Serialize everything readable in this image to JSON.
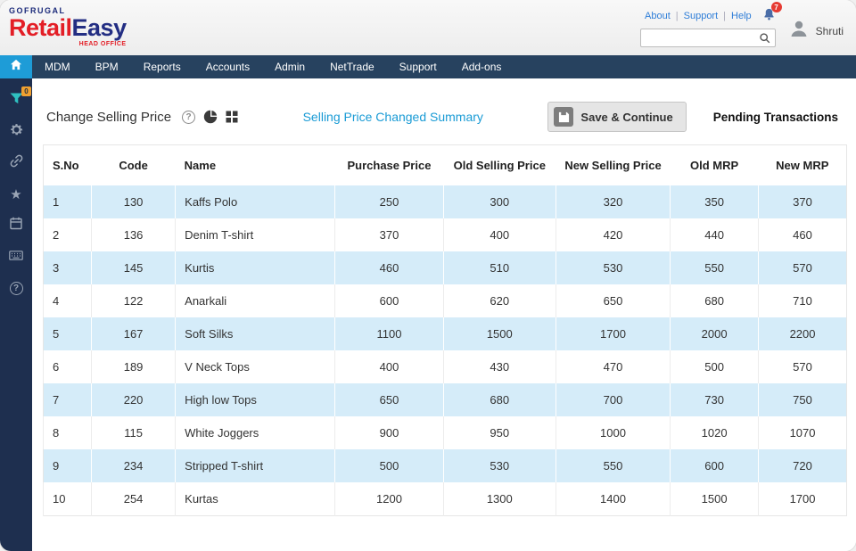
{
  "colors": {
    "navbar": "#27425f",
    "sidebar": "#1e2f4f",
    "accent_blue": "#1e9cd7",
    "link_blue": "#2f7ed8",
    "summary_link": "#1a9bd5",
    "row_alt": "#d5ecf9",
    "badge_red": "#e63b33",
    "badge_orange": "#f0a030",
    "brand_red": "#e31e26",
    "brand_navy": "#232e83"
  },
  "header": {
    "logo": {
      "company": "GOFRUGAL",
      "product_red": "Retail",
      "product_blue": "Easy",
      "suffix": "HEAD OFFICE"
    },
    "links": [
      "About",
      "Support",
      "Help"
    ],
    "notification_count": "7",
    "search_value": "",
    "user_name": "Shruti"
  },
  "nav": {
    "items": [
      "MDM",
      "BPM",
      "Reports",
      "Accounts",
      "Admin",
      "NetTrade",
      "Support",
      "Add-ons"
    ]
  },
  "sidebar": {
    "filter_badge": "0",
    "icons": [
      "filter-icon",
      "gear-icon",
      "link-icon",
      "star-icon",
      "calendar-icon",
      "keyboard-icon",
      "help-icon"
    ]
  },
  "toolbar": {
    "title": "Change Selling Price",
    "summary_link": "Selling Price Changed Summary",
    "save_button": "Save & Continue",
    "pending_label": "Pending Transactions"
  },
  "table": {
    "columns": [
      "S.No",
      "Code",
      "Name",
      "Purchase Price",
      "Old Selling Price",
      "New Selling Price",
      "Old MRP",
      "New MRP"
    ],
    "rows": [
      [
        "1",
        "130",
        "Kaffs Polo",
        "250",
        "300",
        "320",
        "350",
        "370"
      ],
      [
        "2",
        "136",
        "Denim T-shirt",
        "370",
        "400",
        "420",
        "440",
        "460"
      ],
      [
        "3",
        "145",
        "Kurtis",
        "460",
        "510",
        "530",
        "550",
        "570"
      ],
      [
        "4",
        "122",
        "Anarkali",
        "600",
        "620",
        "650",
        "680",
        "710"
      ],
      [
        "5",
        "167",
        "Soft Silks",
        "1100",
        "1500",
        "1700",
        "2000",
        "2200"
      ],
      [
        "6",
        "189",
        "V Neck Tops",
        "400",
        "430",
        "470",
        "500",
        "570"
      ],
      [
        "7",
        "220",
        "High low Tops",
        "650",
        "680",
        "700",
        "730",
        "750"
      ],
      [
        "8",
        "115",
        "White Joggers",
        "900",
        "950",
        "1000",
        "1020",
        "1070"
      ],
      [
        "9",
        "234",
        "Stripped T-shirt",
        "500",
        "530",
        "550",
        "600",
        "720"
      ],
      [
        "10",
        "254",
        "Kurtas",
        "1200",
        "1300",
        "1400",
        "1500",
        "1700"
      ]
    ]
  }
}
